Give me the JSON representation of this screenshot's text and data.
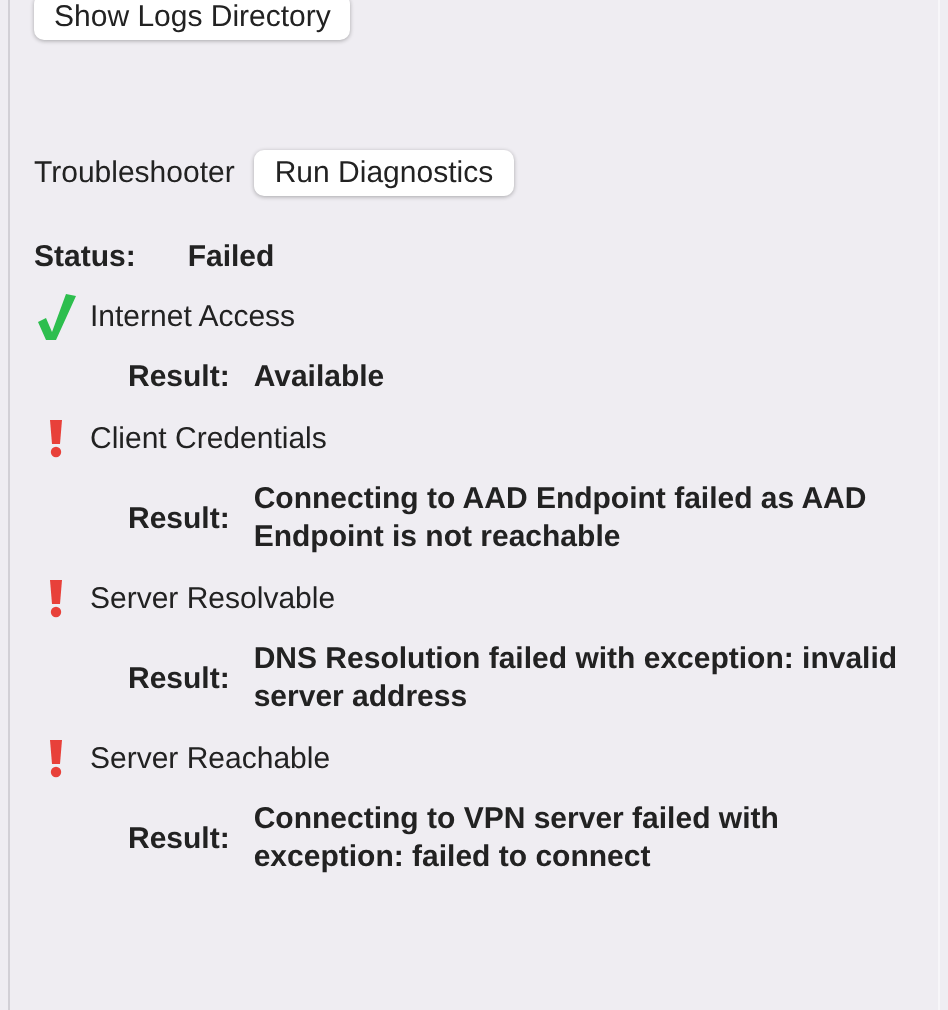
{
  "buttons": {
    "show_logs": "Show Logs Directory",
    "run_diagnostics": "Run Diagnostics"
  },
  "troubleshooter_label": "Troubleshooter",
  "status": {
    "label": "Status:",
    "value": "Failed"
  },
  "checks": [
    {
      "name": "Internet Access",
      "kind": "pass",
      "result_label": "Result:",
      "result": "Available"
    },
    {
      "name": "Client Credentials",
      "kind": "fail",
      "result_label": "Result:",
      "result": "Connecting to AAD Endpoint failed as AAD Endpoint is not reachable"
    },
    {
      "name": "Server Resolvable",
      "kind": "fail",
      "result_label": "Result:",
      "result": "DNS Resolution failed with exception: invalid server address"
    },
    {
      "name": "Server Reachable",
      "kind": "fail",
      "result_label": "Result:",
      "result": "Connecting to VPN server failed with exception: failed to connect"
    }
  ]
}
